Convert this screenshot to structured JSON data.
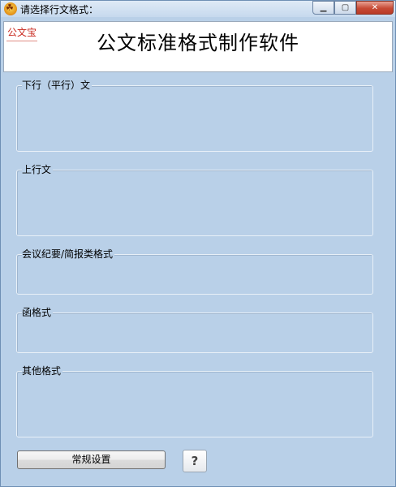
{
  "window": {
    "title": "请选择行文格式：",
    "minimize_glyph": "▁",
    "maximize_glyph": "▢",
    "close_glyph": "✕",
    "close_color": "#c74a35"
  },
  "header": {
    "logo_text": "公文宝",
    "title": "公文标准格式制作软件"
  },
  "groups": [
    {
      "label": "下行（平行）文"
    },
    {
      "label": "上行文"
    },
    {
      "label": "会议纪要/简报类格式"
    },
    {
      "label": "函格式"
    },
    {
      "label": "其他格式"
    }
  ],
  "footer": {
    "settings_label": "常规设置",
    "help_label": "?"
  }
}
